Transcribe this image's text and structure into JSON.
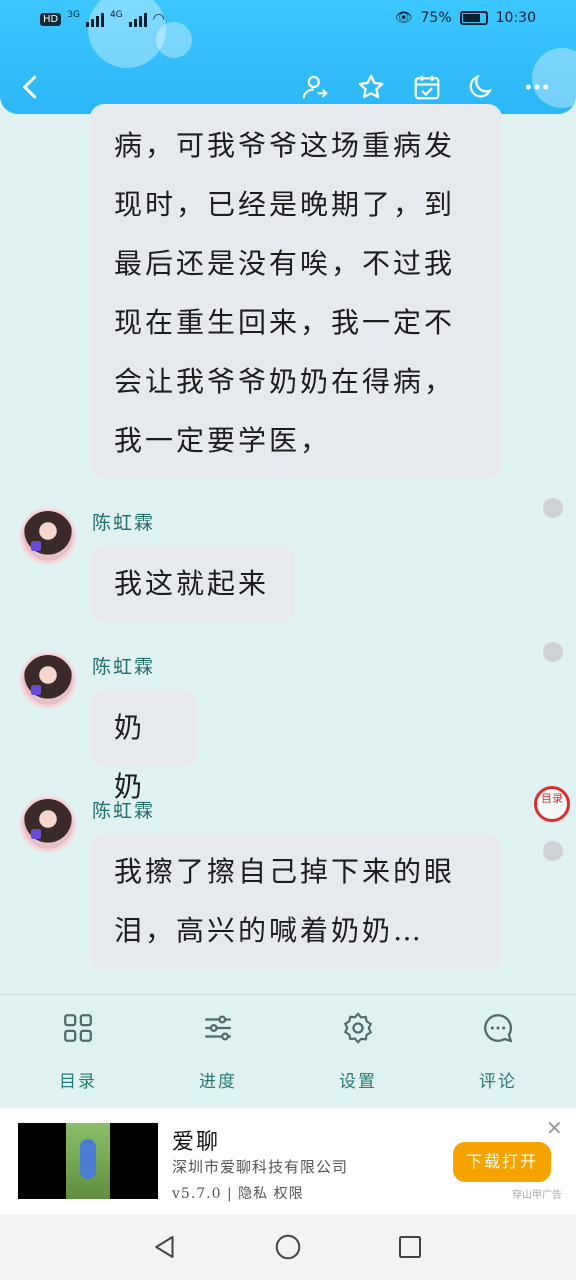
{
  "status_bar": {
    "hd_label": "HD",
    "sim1_label": "3G",
    "sim2_label": "4G",
    "battery_text": "75%",
    "battery_level": 0.75,
    "time": "10:30"
  },
  "toolbar": {
    "icons": [
      "back-icon",
      "user-switch-icon",
      "star-icon",
      "calendar-check-icon",
      "moon-icon",
      "more-icon"
    ]
  },
  "chat": {
    "first_bubble_lines": [
      "病，可我爷爷这场重病发",
      "现时，已经是晚期了，到",
      "最后还是没有唉，不过我",
      "现在重生回来，我一定不",
      "会让我爷爷奶奶在得病，",
      "我一定要学医，"
    ],
    "messages": [
      {
        "name": "陈虹霖",
        "lines": [
          "我这就起来"
        ]
      },
      {
        "name": "陈虹霖",
        "lines": [
          "奶奶"
        ]
      },
      {
        "name": "陈虹霖",
        "lines": [
          "我擦了擦自己掉下来的眼",
          "泪，高兴的喊着奶奶…"
        ]
      }
    ],
    "marker_label": "目录"
  },
  "menu": {
    "items": [
      {
        "label": "目录",
        "icon": "grid-icon"
      },
      {
        "label": "进度",
        "icon": "sliders-icon"
      },
      {
        "label": "设置",
        "icon": "gear-icon"
      },
      {
        "label": "评论",
        "icon": "comment-icon"
      }
    ]
  },
  "ad": {
    "title": "爱聊",
    "company": "深圳市爱聊科技有限公司",
    "meta": "v5.7.0 | 隐私 权限",
    "button": "下载打开",
    "tag": "穿山甲广告",
    "close": "✕"
  },
  "colors": {
    "header": "#2bb6f6",
    "background": "#dff1f1",
    "bubble": "#e6e9ee",
    "accent_text": "#2a7b76",
    "ad_button": "#f5a300"
  }
}
